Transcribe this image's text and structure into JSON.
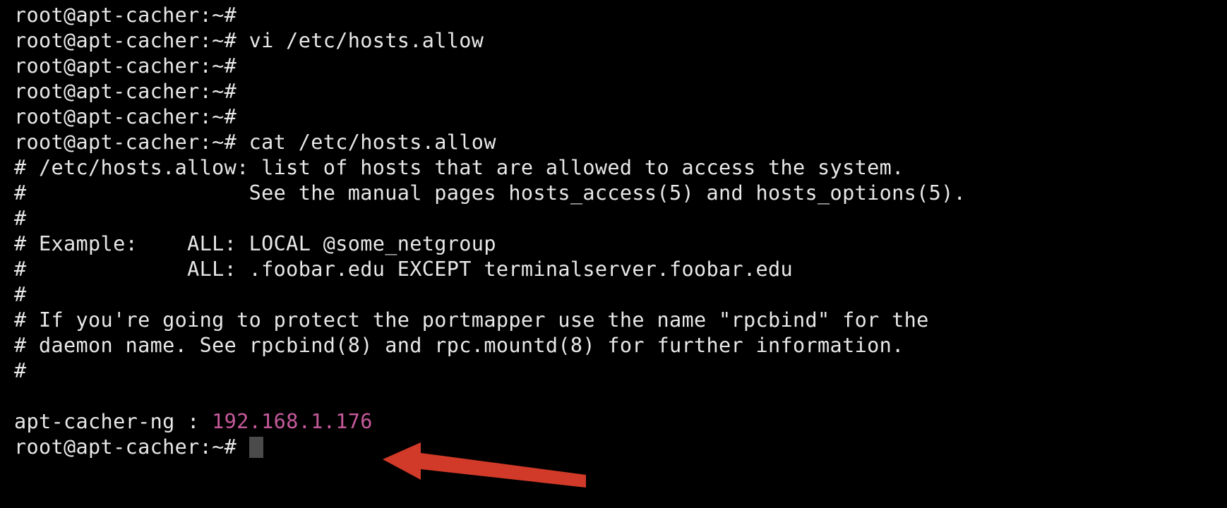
{
  "terminal": {
    "background_color": "#000000",
    "foreground_color": "#e8e8e8",
    "ip_color": "#c75a9c",
    "cursor_color": "#4b4b4b",
    "prompt": "root@apt-cacher:~#",
    "hostname": "apt-cacher",
    "user": "root",
    "lines": [
      {
        "id": "l1",
        "text": "root@apt-cacher:~#"
      },
      {
        "id": "l2",
        "text": "root@apt-cacher:~# vi /etc/hosts.allow"
      },
      {
        "id": "l3",
        "text": "root@apt-cacher:~#"
      },
      {
        "id": "l4",
        "text": "root@apt-cacher:~#"
      },
      {
        "id": "l5",
        "text": "root@apt-cacher:~#"
      },
      {
        "id": "l6",
        "text": "root@apt-cacher:~# cat /etc/hosts.allow"
      },
      {
        "id": "l7",
        "text": "# /etc/hosts.allow: list of hosts that are allowed to access the system."
      },
      {
        "id": "l8",
        "text": "#                  See the manual pages hosts_access(5) and hosts_options(5)."
      },
      {
        "id": "l9",
        "text": "#"
      },
      {
        "id": "l10",
        "text": "# Example:    ALL: LOCAL @some_netgroup"
      },
      {
        "id": "l11",
        "text": "#             ALL: .foobar.edu EXCEPT terminalserver.foobar.edu"
      },
      {
        "id": "l12",
        "text": "#"
      },
      {
        "id": "l13",
        "text": "# If you're going to protect the portmapper use the name \"rpcbind\" for the"
      },
      {
        "id": "l14",
        "text": "# daemon name. See rpcbind(8) and rpc.mountd(8) for further information."
      },
      {
        "id": "l15",
        "text": "#"
      },
      {
        "id": "l16",
        "text": ""
      }
    ],
    "entry_line": {
      "service": "apt-cacher-ng : ",
      "ip_address": "192.168.1.176"
    },
    "final_prompt": "root@apt-cacher:~# "
  },
  "annotation": {
    "type": "arrow",
    "direction": "left",
    "color": "#d13a28",
    "points_at": "192.168.1.176"
  }
}
